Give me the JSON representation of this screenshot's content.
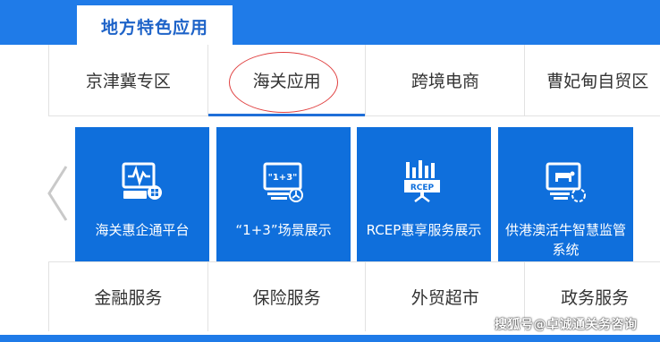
{
  "section": {
    "title": "地方特色应用"
  },
  "tabs": [
    {
      "label": "京津冀专区"
    },
    {
      "label": "海关应用"
    },
    {
      "label": "跨境电商"
    },
    {
      "label": "曹妃甸自贸区"
    }
  ],
  "cards": [
    {
      "label": "海关惠企通平台",
      "icon": "monitor-pulse-icon"
    },
    {
      "label": "“1+3”场景展示",
      "icon": "monitor-1plus3-icon",
      "icon_text": "\"1+3\""
    },
    {
      "label": "RCEP惠享服务展示",
      "icon": "rcep-chart-icon",
      "icon_text": "RCEP"
    },
    {
      "label": "供港澳活牛智慧监管系统",
      "icon": "monitor-cattle-icon"
    }
  ],
  "bottom": [
    {
      "label": "金融服务"
    },
    {
      "label": "保险服务"
    },
    {
      "label": "外贸超市"
    },
    {
      "label": "政务服务"
    }
  ],
  "watermark": "搜狐号@卓诚通关务咨询",
  "colors": {
    "brand_blue": "#1f7be8",
    "card_blue": "#0f6fdc",
    "title_blue": "#1e63c8",
    "ring_red": "#e04040"
  }
}
